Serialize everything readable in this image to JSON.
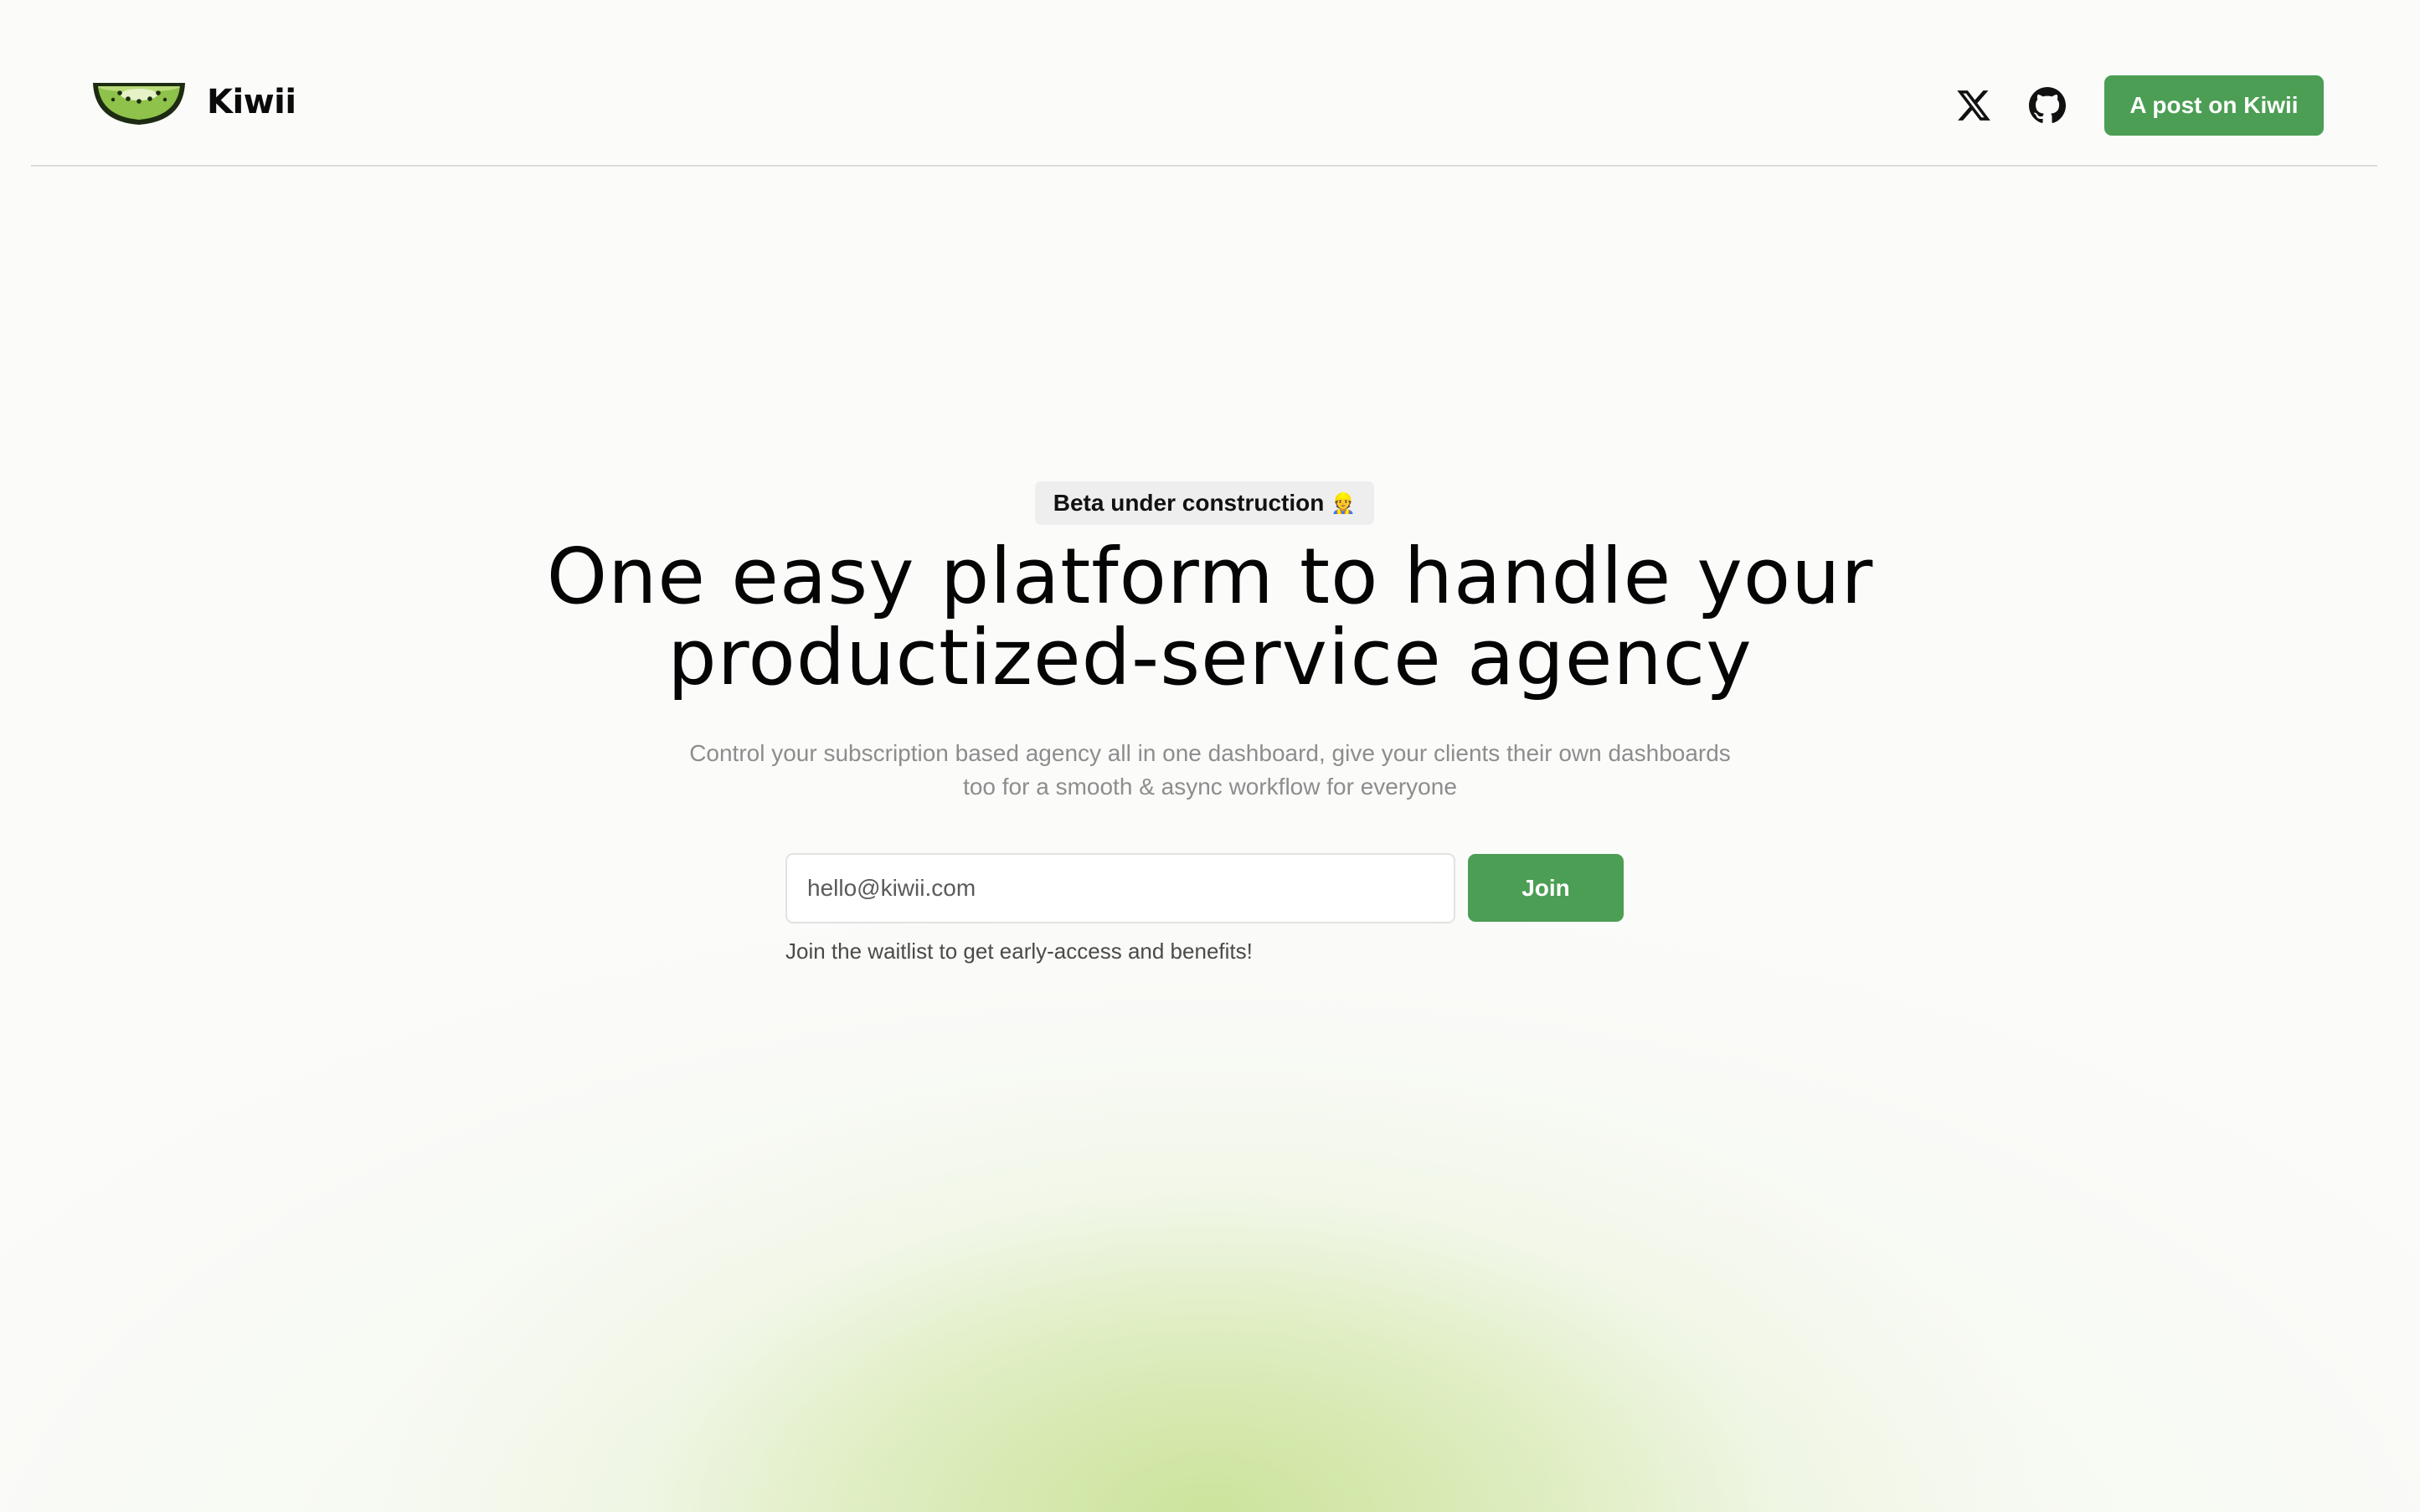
{
  "brand": {
    "name": "Kiwii",
    "accent_color": "#4b9e54",
    "logo": "kiwi-slice-logo"
  },
  "header": {
    "social": [
      {
        "name": "x-icon",
        "label": "X"
      },
      {
        "name": "github-icon",
        "label": "GitHub"
      }
    ],
    "cta_label": "A post on Kiwii"
  },
  "hero": {
    "badge_text": "Beta under construction",
    "badge_emoji": "👷",
    "headline_line1": "One easy platform to handle your",
    "headline_line2": "productized-service agency",
    "subtext_line1": "Control your subscription based agency all in one dashboard, give your clients their own dashboards",
    "subtext_line2": "too for a smooth & async workflow for everyone"
  },
  "waitlist": {
    "email_placeholder": "hello@kiwii.com",
    "email_value": "",
    "join_label": "Join",
    "hint": "Join the waitlist to get early-access and benefits!"
  }
}
